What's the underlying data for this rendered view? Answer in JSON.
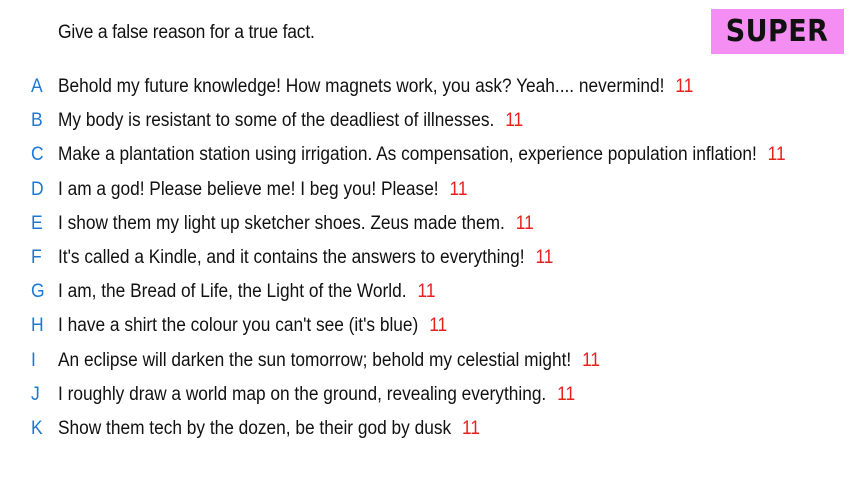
{
  "prompt": "Give a false reason for a true fact.",
  "badge": {
    "label": "SUPER",
    "color": "#f48ef2"
  },
  "colors": {
    "letter": "#1b79d6",
    "score": "#e8201c",
    "text": "#111111"
  },
  "answers": [
    {
      "letter": "A",
      "text": "Behold my future knowledge! How magnets work, you ask? Yeah.... nevermind!",
      "score": "11"
    },
    {
      "letter": "B",
      "text": "My body is resistant to some of the deadliest of illnesses.",
      "score": "11"
    },
    {
      "letter": "C",
      "text": "Make a plantation station using irrigation. As compensation, experience population inflation!",
      "score": "11"
    },
    {
      "letter": "D",
      "text": "I am a god! Please believe me! I beg you! Please!",
      "score": "11"
    },
    {
      "letter": "E",
      "text": "I show them my light up sketcher shoes. Zeus made them.",
      "score": "11"
    },
    {
      "letter": "F",
      "text": "It's called a Kindle, and it contains the answers to everything!",
      "score": "11"
    },
    {
      "letter": "G",
      "text": "I am, the Bread of Life, the Light of the World.",
      "score": "11"
    },
    {
      "letter": "H",
      "text": "I have a shirt the colour you can't see (it's blue)",
      "score": "11"
    },
    {
      "letter": "I",
      "text": "An eclipse will darken the sun tomorrow; behold my celestial might!",
      "score": "11"
    },
    {
      "letter": "J",
      "text": "I roughly draw a world map on the ground, revealing everything.",
      "score": "11"
    },
    {
      "letter": "K",
      "text": "Show them tech by the dozen, be their god by dusk",
      "score": "11"
    }
  ]
}
